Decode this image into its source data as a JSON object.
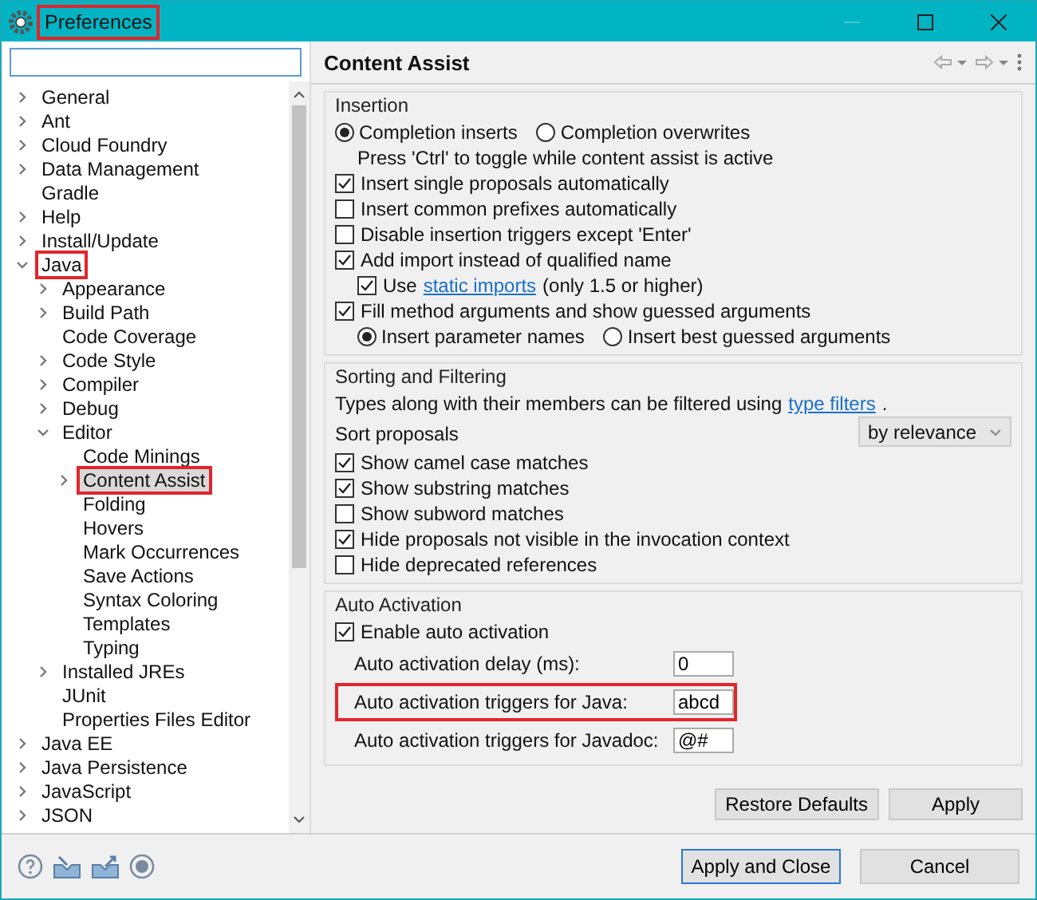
{
  "window": {
    "title": "Preferences",
    "title_highlighted": true
  },
  "tree": [
    {
      "label": "General",
      "kind": "branch",
      "expanded": false,
      "selected": false,
      "highlighted": false
    },
    {
      "label": "Ant",
      "kind": "branch",
      "expanded": false,
      "selected": false,
      "highlighted": false
    },
    {
      "label": "Cloud Foundry",
      "kind": "branch",
      "expanded": false,
      "selected": false,
      "highlighted": false
    },
    {
      "label": "Data Management",
      "kind": "branch",
      "expanded": false,
      "selected": false,
      "highlighted": false
    },
    {
      "label": "Gradle",
      "kind": "leaf",
      "selected": false,
      "highlighted": false
    },
    {
      "label": "Help",
      "kind": "branch",
      "expanded": false,
      "selected": false,
      "highlighted": false
    },
    {
      "label": "Install/Update",
      "kind": "branch",
      "expanded": false,
      "selected": false,
      "highlighted": false
    },
    {
      "label": "Java",
      "kind": "branch",
      "expanded": true,
      "selected": false,
      "highlighted": true,
      "children": [
        {
          "label": "Appearance",
          "kind": "branch",
          "expanded": false,
          "selected": false,
          "highlighted": false
        },
        {
          "label": "Build Path",
          "kind": "branch",
          "expanded": false,
          "selected": false,
          "highlighted": false
        },
        {
          "label": "Code Coverage",
          "kind": "leaf",
          "selected": false,
          "highlighted": false
        },
        {
          "label": "Code Style",
          "kind": "branch",
          "expanded": false,
          "selected": false,
          "highlighted": false
        },
        {
          "label": "Compiler",
          "kind": "branch",
          "expanded": false,
          "selected": false,
          "highlighted": false
        },
        {
          "label": "Debug",
          "kind": "branch",
          "expanded": false,
          "selected": false,
          "highlighted": false
        },
        {
          "label": "Editor",
          "kind": "branch",
          "expanded": true,
          "selected": false,
          "highlighted": false,
          "children": [
            {
              "label": "Code Minings",
              "kind": "leaf",
              "selected": false,
              "highlighted": false
            },
            {
              "label": "Content Assist",
              "kind": "branch",
              "expanded": false,
              "selected": true,
              "highlighted": true
            },
            {
              "label": "Folding",
              "kind": "leaf",
              "selected": false,
              "highlighted": false
            },
            {
              "label": "Hovers",
              "kind": "leaf",
              "selected": false,
              "highlighted": false
            },
            {
              "label": "Mark Occurrences",
              "kind": "leaf",
              "selected": false,
              "highlighted": false
            },
            {
              "label": "Save Actions",
              "kind": "leaf",
              "selected": false,
              "highlighted": false
            },
            {
              "label": "Syntax Coloring",
              "kind": "leaf",
              "selected": false,
              "highlighted": false
            },
            {
              "label": "Templates",
              "kind": "leaf",
              "selected": false,
              "highlighted": false
            },
            {
              "label": "Typing",
              "kind": "leaf",
              "selected": false,
              "highlighted": false
            }
          ]
        },
        {
          "label": "Installed JREs",
          "kind": "branch",
          "expanded": false,
          "selected": false,
          "highlighted": false
        },
        {
          "label": "JUnit",
          "kind": "leaf",
          "selected": false,
          "highlighted": false
        },
        {
          "label": "Properties Files Editor",
          "kind": "leaf",
          "selected": false,
          "highlighted": false
        }
      ]
    },
    {
      "label": "Java EE",
      "kind": "branch",
      "expanded": false,
      "selected": false,
      "highlighted": false
    },
    {
      "label": "Java Persistence",
      "kind": "branch",
      "expanded": false,
      "selected": false,
      "highlighted": false
    },
    {
      "label": "JavaScript",
      "kind": "branch",
      "expanded": false,
      "selected": false,
      "highlighted": false
    },
    {
      "label": "JSON",
      "kind": "branch",
      "expanded": false,
      "selected": false,
      "highlighted": false
    }
  ],
  "page": {
    "title": "Content Assist",
    "groups": [
      {
        "title": "Insertion",
        "rows": [
          {
            "kind": "radios",
            "options": [
              {
                "label": "Completion inserts",
                "selected": true
              },
              {
                "label": "Completion overwrites",
                "selected": false
              }
            ]
          },
          {
            "kind": "note",
            "text": "Press 'Ctrl' to toggle while content assist is active"
          },
          {
            "kind": "checkbox",
            "label": "Insert single proposals automatically",
            "checked": true
          },
          {
            "kind": "checkbox",
            "label": "Insert common prefixes automatically",
            "checked": false
          },
          {
            "kind": "checkbox",
            "label": "Disable insertion triggers except 'Enter'",
            "checked": false
          },
          {
            "kind": "checkbox",
            "label": "Add import instead of qualified name",
            "checked": true,
            "children": [
              {
                "kind": "checkbox",
                "label": "Use",
                "link": "static imports",
                "suffix": "(only 1.5 or higher)",
                "checked": true
              }
            ]
          },
          {
            "kind": "checkbox",
            "label": "Fill method arguments and show guessed arguments",
            "checked": true,
            "children": [
              {
                "kind": "radios",
                "options": [
                  {
                    "label": "Insert parameter names",
                    "selected": true
                  },
                  {
                    "label": "Insert best guessed arguments",
                    "selected": false
                  }
                ]
              }
            ]
          }
        ]
      },
      {
        "title": "Sorting and Filtering",
        "rows": [
          {
            "kind": "note",
            "text": "Types along with their members can be filtered using",
            "link": "type filters",
            "suffix": "."
          },
          {
            "kind": "dropdown",
            "label": "Sort proposals",
            "value": "by relevance"
          },
          {
            "kind": "checkbox",
            "label": "Show camel case matches",
            "checked": true
          },
          {
            "kind": "checkbox",
            "label": "Show substring matches",
            "checked": true
          },
          {
            "kind": "checkbox",
            "label": "Show subword matches",
            "checked": false
          },
          {
            "kind": "checkbox",
            "label": "Hide proposals not visible in the invocation context",
            "checked": true
          },
          {
            "kind": "checkbox",
            "label": "Hide deprecated references",
            "checked": false
          }
        ]
      },
      {
        "title": "Auto Activation",
        "rows": [
          {
            "kind": "checkbox",
            "label": "Enable auto activation",
            "checked": true
          },
          {
            "kind": "field",
            "label": "Auto activation delay (ms):",
            "value": "0",
            "highlighted": false
          },
          {
            "kind": "field",
            "label": "Auto activation triggers for Java:",
            "value": "abcd",
            "highlighted": true
          },
          {
            "kind": "field",
            "label": "Auto activation triggers for Javadoc:",
            "value": "@#",
            "highlighted": false
          }
        ]
      }
    ],
    "buttons": [
      "Restore Defaults",
      "Apply"
    ]
  },
  "dialog_buttons": [
    {
      "label": "Apply and Close",
      "default": true
    },
    {
      "label": "Cancel",
      "default": false
    }
  ]
}
